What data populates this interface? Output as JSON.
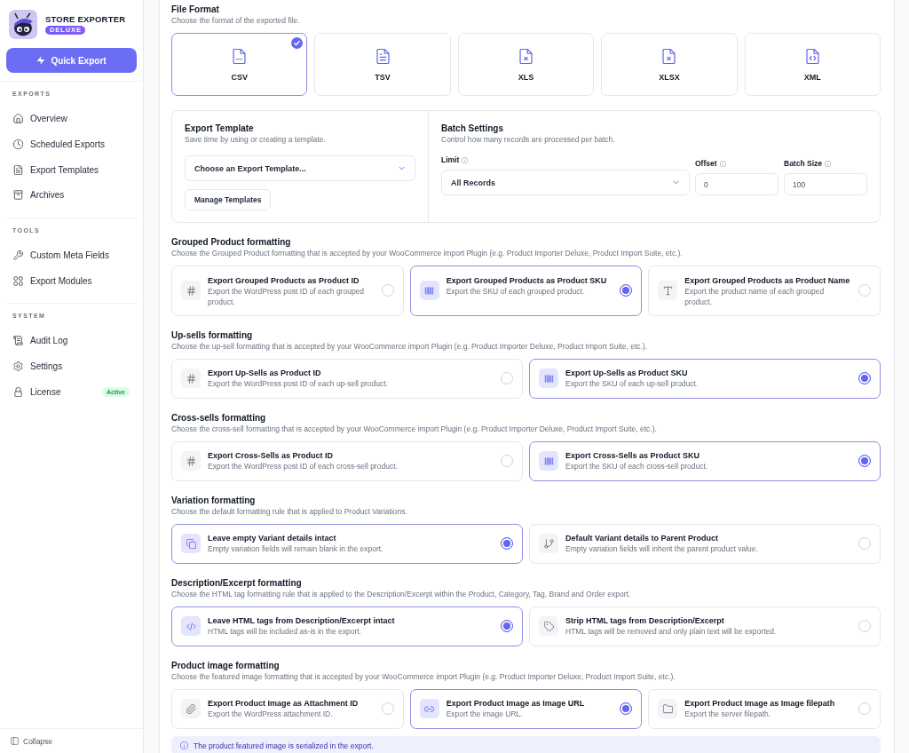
{
  "sidebar": {
    "brand": {
      "title": "STORE EXPORTER",
      "badge": "DELUXE"
    },
    "quick_export": "Quick Export",
    "sections": [
      {
        "label": "EXPORTS",
        "items": [
          {
            "label": "Overview",
            "selected": false
          },
          {
            "label": "Scheduled Exports",
            "selected": false
          },
          {
            "label": "Export Templates",
            "selected": false
          },
          {
            "label": "Archives",
            "selected": false
          }
        ]
      },
      {
        "label": "TOOLS",
        "items": [
          {
            "label": "Custom Meta Fields",
            "selected": false
          },
          {
            "label": "Export Modules",
            "selected": false
          }
        ]
      },
      {
        "label": "SYSTEM",
        "items": [
          {
            "label": "Audit Log",
            "selected": false
          },
          {
            "label": "Settings",
            "selected": false
          },
          {
            "label": "License",
            "selected": false,
            "badge": "Active"
          }
        ]
      }
    ],
    "collapse": "Collapse"
  },
  "file_format": {
    "title": "File Format",
    "subtitle": "Choose the format of the exported file.",
    "formats": [
      {
        "label": "CSV",
        "selected": true
      },
      {
        "label": "TSV",
        "selected": false
      },
      {
        "label": "XLS",
        "selected": false
      },
      {
        "label": "XLSX",
        "selected": false
      },
      {
        "label": "XML",
        "selected": false
      }
    ]
  },
  "export_template": {
    "title": "Export Template",
    "subtitle": "Save time by using or creating a template.",
    "select": {
      "value": "Choose an Export Template..."
    },
    "button": "Manage Templates"
  },
  "batch_settings": {
    "title": "Batch Settings",
    "subtitle": "Control how many records are processed per batch.",
    "fields": [
      {
        "label": "Limit",
        "kind": "select",
        "value": "All Records"
      },
      {
        "label": "Offset",
        "kind": "input",
        "value": "0"
      },
      {
        "label": "Batch Size",
        "kind": "input",
        "value": "100"
      }
    ]
  },
  "formatting_sections": [
    {
      "title": "Grouped Product formatting",
      "subtitle": "Choose the Grouped Product formatting that is accepted by your WooCommerce import Plugin (e.g. Product Importer Deluxe, Product Import Suite, etc.).",
      "options": [
        {
          "title": "Export Grouped Products as Product ID",
          "description": "Export the WordPress post ID of each grouped product.",
          "selected": false
        },
        {
          "title": "Export Grouped Products as Product SKU",
          "description": "Export the SKU of each grouped product.",
          "selected": true
        },
        {
          "title": "Export Grouped Products as Product Name",
          "description": "Export the product name of each grouped product.",
          "selected": false
        }
      ]
    },
    {
      "title": "Up-sells formatting",
      "subtitle": "Choose the up-sell formatting that is accepted by your WooCommerce import Plugin (e.g. Product Importer Deluxe, Product Import Suite, etc.).",
      "options": [
        {
          "title": "Export Up-Sells as Product ID",
          "description": "Export the WordPress post ID of each up-sell product.",
          "selected": false
        },
        {
          "title": "Export Up-Sells as Product SKU",
          "description": "Export the SKU of each up-sell product.",
          "selected": true
        }
      ]
    },
    {
      "title": "Cross-sells formatting",
      "subtitle": "Choose the cross-sell formatting that is accepted by your WooCommerce import Plugin (e.g. Product Importer Deluxe, Product Import Suite, etc.).",
      "options": [
        {
          "title": "Export Cross-Sells as Product ID",
          "description": "Export the WordPress post ID of each cross-sell product.",
          "selected": false
        },
        {
          "title": "Export Cross-Sells as Product SKU",
          "description": "Export the SKU of each cross-sell product.",
          "selected": true
        }
      ]
    },
    {
      "title": "Variation formatting",
      "subtitle": "Choose the default formatting rule that is applied to Product Variations.",
      "options": [
        {
          "title": "Leave empty Variant details intact",
          "description": "Empty variation fields will remain blank in the export.",
          "selected": true
        },
        {
          "title": "Default Variant details to Parent Product",
          "description": "Empty variation fields will inherit the parent product value.",
          "selected": false
        }
      ]
    },
    {
      "title": "Description/Excerpt formatting",
      "subtitle": "Choose the HTML tag formatting rule that is applied to the Description/Excerpt within the Product, Category, Tag, Brand and Order export.",
      "options": [
        {
          "title": "Leave HTML tags from Description/Excerpt intact",
          "description": "HTML tags will be included as-is in the export.",
          "selected": true
        },
        {
          "title": "Strip HTML tags from Description/Excerpt",
          "description": "HTML tags will be removed and only plain text will be exported.",
          "selected": false
        }
      ]
    },
    {
      "title": "Product image formatting",
      "subtitle": "Choose the featured image formatting that is accepted by your WooCommerce import Plugin (e.g. Product Importer Deluxe, Product Import Suite, etc.).",
      "options": [
        {
          "title": "Export Product Image as Attachment ID",
          "description": "Export the WordPress attachment ID.",
          "selected": false
        },
        {
          "title": "Export Product Image as Image URL",
          "description": "Export the image URL.",
          "selected": true
        },
        {
          "title": "Export Product Image as Image filepath",
          "description": "Export the server filepath.",
          "selected": false
        }
      ],
      "note": "The product featured image is serialized in the export."
    }
  ]
}
